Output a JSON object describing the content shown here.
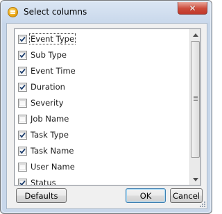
{
  "window": {
    "title": "Select columns"
  },
  "columns": [
    {
      "label": "Event Type",
      "checked": true,
      "focused": true
    },
    {
      "label": "Sub Type",
      "checked": true
    },
    {
      "label": "Event Time",
      "checked": true
    },
    {
      "label": "Duration",
      "checked": true
    },
    {
      "label": "Severity",
      "checked": false
    },
    {
      "label": "Job Name",
      "checked": false
    },
    {
      "label": "Task Type",
      "checked": true
    },
    {
      "label": "Task Name",
      "checked": true
    },
    {
      "label": "User Name",
      "checked": false
    },
    {
      "label": "Status",
      "checked": true
    }
  ],
  "buttons": {
    "defaults": "Defaults",
    "ok": "OK",
    "cancel": "Cancel"
  },
  "colors": {
    "title_bar": "#c9d8eb",
    "close": "#c0392b",
    "check": "#1e3f6e"
  },
  "icons": {
    "app": "app-menu-icon",
    "close": "close-icon",
    "check": "checkmark-icon"
  }
}
